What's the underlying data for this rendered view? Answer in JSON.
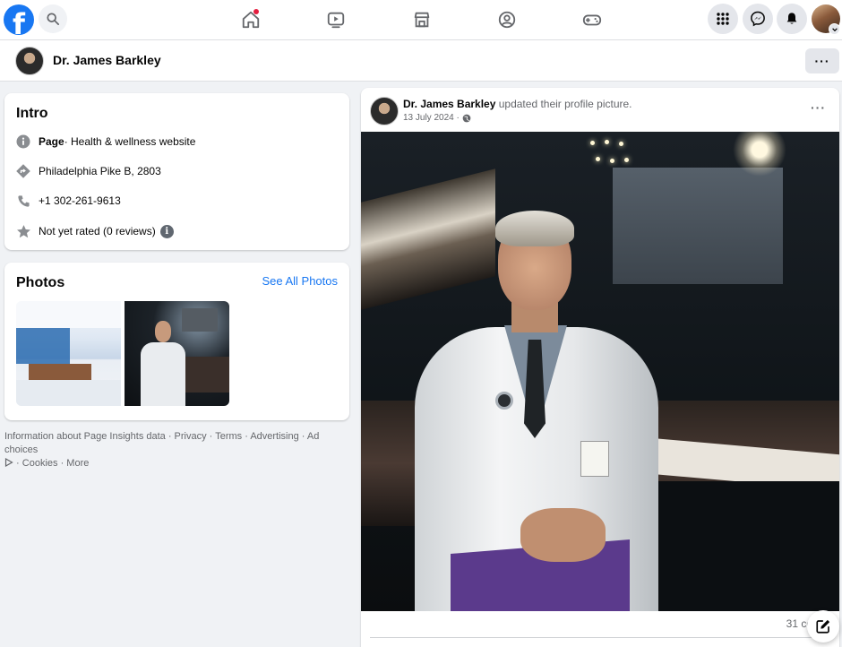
{
  "nav": {
    "logo_letter": "f",
    "icons": [
      "facebook-logo",
      "search-icon",
      "home-icon",
      "video-icon",
      "marketplace-icon",
      "groups-icon",
      "gaming-icon",
      "menu-grid-icon",
      "messenger-icon",
      "notifications-icon",
      "account-avatar"
    ],
    "accent": "#1877f2",
    "notification_dot_color": "#e41e3f"
  },
  "page_header": {
    "name": "Dr. James Barkley",
    "more_label": "···"
  },
  "intro": {
    "title": "Intro",
    "page_label": "Page",
    "page_category": " · Health & wellness website",
    "address": "Philadelphia Pike B, 2803",
    "phone": "+1 302-261-9613",
    "rating": "Not yet rated (0 reviews)",
    "info_glyph": "i"
  },
  "photos": {
    "title": "Photos",
    "see_all": "See All Photos"
  },
  "footer": {
    "line1": "Information about Page Insights data · Privacy · Terms · Advertising · Ad choices",
    "line2": " · Cookies · More"
  },
  "post": {
    "author": "Dr. James Barkley",
    "action": " updated their profile picture.",
    "date": "13 July 2024 ·",
    "more_label": "···",
    "comments": "31 comm"
  }
}
